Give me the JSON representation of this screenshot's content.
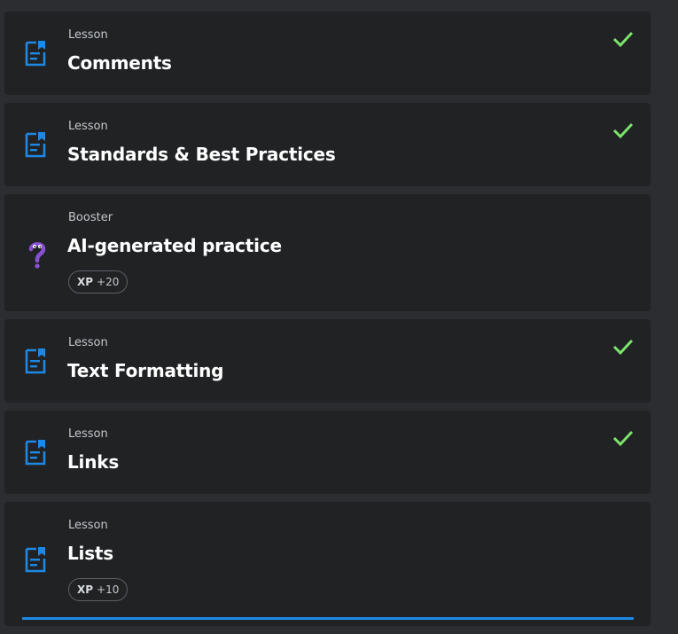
{
  "items": [
    {
      "kind": "Lesson",
      "title": "Comments",
      "completed": true,
      "xp": null,
      "icon": "lesson-icon"
    },
    {
      "kind": "Lesson",
      "title": "Standards & Best Practices",
      "completed": true,
      "xp": null,
      "icon": "lesson-icon"
    },
    {
      "kind": "Booster",
      "title": "AI-generated practice",
      "completed": false,
      "xp": {
        "label": "XP",
        "value": "+20"
      },
      "icon": "question-mascot-icon"
    },
    {
      "kind": "Lesson",
      "title": "Text Formatting",
      "completed": true,
      "xp": null,
      "icon": "lesson-icon"
    },
    {
      "kind": "Lesson",
      "title": "Links",
      "completed": true,
      "xp": null,
      "icon": "lesson-icon"
    },
    {
      "kind": "Lesson",
      "title": "Lists",
      "completed": false,
      "xp": {
        "label": "XP",
        "value": "+10"
      },
      "icon": "lesson-icon"
    }
  ],
  "colors": {
    "background": "#2b2d31",
    "card": "#202224",
    "lesson_icon": "#1e88e5",
    "check": "#7ce36b",
    "booster_icon": "#8b4fd6",
    "progress_bar": "#1e88e5"
  }
}
